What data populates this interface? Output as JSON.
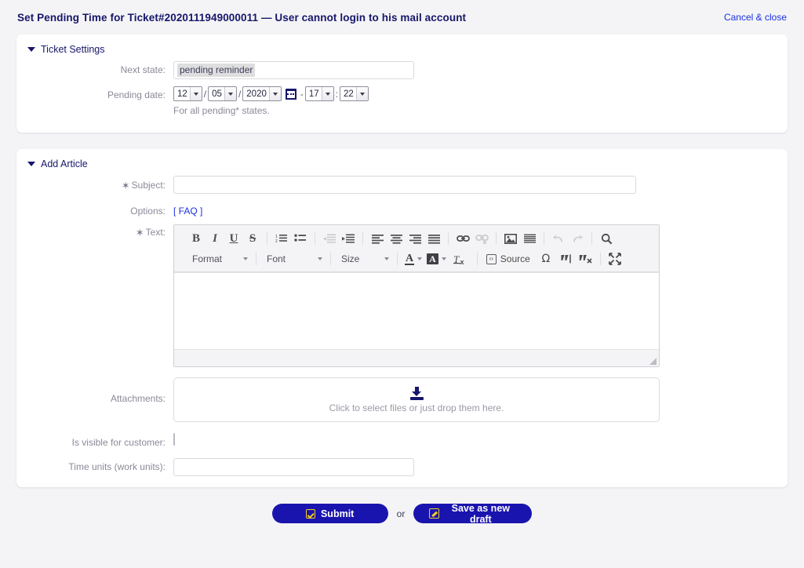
{
  "header": {
    "title": "Set Pending Time for Ticket#2020111949000011 — User cannot login to his mail account",
    "cancel_label": "Cancel & close"
  },
  "ticket_settings": {
    "section_title": "Ticket Settings",
    "next_state": {
      "label": "Next state:",
      "value": "pending reminder"
    },
    "pending_date": {
      "label": "Pending date:",
      "day": "12",
      "month": "05",
      "year": "2020",
      "hour": "17",
      "minute": "22",
      "sep_date": "/",
      "sep_dt": "-",
      "sep_time": ":",
      "hint": "For all pending* states.",
      "calendar_icon": "calendar-icon"
    }
  },
  "add_article": {
    "section_title": "Add Article",
    "subject": {
      "label": "Subject:",
      "required_mark": "✶",
      "value": "",
      "placeholder": ""
    },
    "options": {
      "label": "Options:",
      "faq_label": "[ FAQ ]"
    },
    "text": {
      "label": "Text:",
      "required_mark": "✶",
      "value": ""
    },
    "attachments": {
      "label": "Attachments:",
      "dropzone_text": "Click to select files or just drop them here.",
      "icon": "download-tray-icon"
    },
    "visible_for_customer": {
      "label": "Is visible for customer:",
      "checked": false
    },
    "time_units": {
      "label": "Time units (work units):",
      "value": ""
    }
  },
  "editor": {
    "toolbar_row1": [
      {
        "name": "bold-icon",
        "glyph": "B",
        "style": "b-bold",
        "disabled": false
      },
      {
        "name": "italic-icon",
        "glyph": "I",
        "style": "b-ital",
        "disabled": false
      },
      {
        "name": "underline-icon",
        "glyph": "U",
        "style": "b-und",
        "disabled": false
      },
      {
        "name": "strikethrough-icon",
        "glyph": "S",
        "style": "b-strk",
        "disabled": false
      },
      {
        "name": "numbered-list-icon",
        "disabled": false
      },
      {
        "name": "bulleted-list-icon",
        "disabled": false
      },
      {
        "name": "outdent-icon",
        "disabled": true
      },
      {
        "name": "indent-icon",
        "disabled": false
      },
      {
        "name": "align-left-icon",
        "disabled": false
      },
      {
        "name": "align-center-icon",
        "disabled": false
      },
      {
        "name": "align-right-icon",
        "disabled": false
      },
      {
        "name": "justify-icon",
        "disabled": false
      },
      {
        "name": "link-icon",
        "disabled": false
      },
      {
        "name": "unlink-icon",
        "disabled": true
      },
      {
        "name": "image-icon",
        "disabled": false
      },
      {
        "name": "horizontal-rule-icon",
        "disabled": false
      },
      {
        "name": "undo-icon",
        "disabled": true
      },
      {
        "name": "redo-icon",
        "disabled": true
      },
      {
        "name": "find-icon",
        "disabled": false
      }
    ],
    "combos": {
      "format_label": "Format",
      "font_label": "Font",
      "size_label": "Size"
    },
    "source_label": "Source",
    "row2_icons": {
      "text_color": "text-color-icon",
      "bg_color": "background-color-icon",
      "remove_format": "remove-format-icon",
      "source": "source-icon",
      "special_char": "special-character-icon",
      "blockquote_add": "blockquote-add-icon",
      "blockquote_remove": "blockquote-remove-icon",
      "maximize": "maximize-icon"
    },
    "glyphs": {
      "omega": "Ω",
      "quote_add": "❞",
      "quote_remove": "❞",
      "remove_format": "T",
      "remove_format_sub": "x",
      "source_chevrons": "‹›",
      "a_letter": "A"
    },
    "resize_handle": "editor-resize-handle"
  },
  "footer": {
    "submit_label": "Submit",
    "or_label": "or",
    "draft_label": "Save as new draft",
    "submit_icon": "checkbox-checked-icon",
    "draft_icon": "pencil-edit-icon"
  },
  "colors": {
    "accent_blue": "#1a14ae",
    "link_blue": "#1b30e0",
    "title_navy": "#16166b",
    "label_gray": "#8a8a99",
    "page_bg": "#f4f4f6",
    "icon_yellow": "#f5d020"
  }
}
